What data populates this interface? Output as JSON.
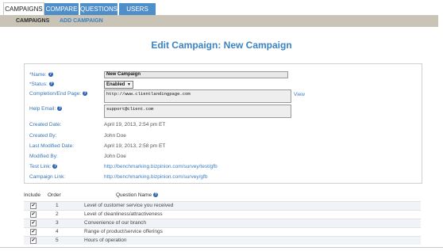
{
  "tabs": [
    "CAMPAIGNS",
    "COMPARE",
    "QUESTIONS",
    "USERS"
  ],
  "subnav": {
    "active": "CAMPAIGNS",
    "link": "ADD CAMPAIGN"
  },
  "page_title": "Edit Campaign: New Campaign",
  "form": {
    "name_label": "*Name:",
    "name_value": "New Campaign",
    "status_label": "*Status:",
    "status_value": "Enabled",
    "completion_label": "Completion/End Page:",
    "completion_value": "http://www.clientlandingpage.com",
    "completion_view": "View",
    "help_label": "Help Email:",
    "help_value": "support@client.com",
    "created_date_label": "Created Date:",
    "created_date_value": "April 19, 2013, 2:54 pm ET",
    "created_by_label": "Created By:",
    "created_by_value": "John Doe",
    "modified_date_label": "Last Modified Date:",
    "modified_date_value": "April 19, 2013, 2:58 pm ET",
    "modified_by_label": "Modified By:",
    "modified_by_value": "John Doe",
    "test_link_label": "Test Link:",
    "test_link_value": "http://benchmarking.bizpinion.com/survey/test/gfb",
    "campaign_link_label": "Campaign Link:",
    "campaign_link_value": "http://benchmarking.bizpinion.com/survey/gfb"
  },
  "questions": {
    "headers": {
      "include": "Include",
      "order": "Order",
      "name": "Question Name"
    },
    "rows": [
      {
        "order": "1",
        "name": "Level of customer service you received"
      },
      {
        "order": "2",
        "name": "Level of cleanliness/attractiveness"
      },
      {
        "order": "3",
        "name": "Convenience of our branch"
      },
      {
        "order": "4",
        "name": "Range of product/service offerings"
      },
      {
        "order": "5",
        "name": "Hours of operation"
      }
    ]
  }
}
